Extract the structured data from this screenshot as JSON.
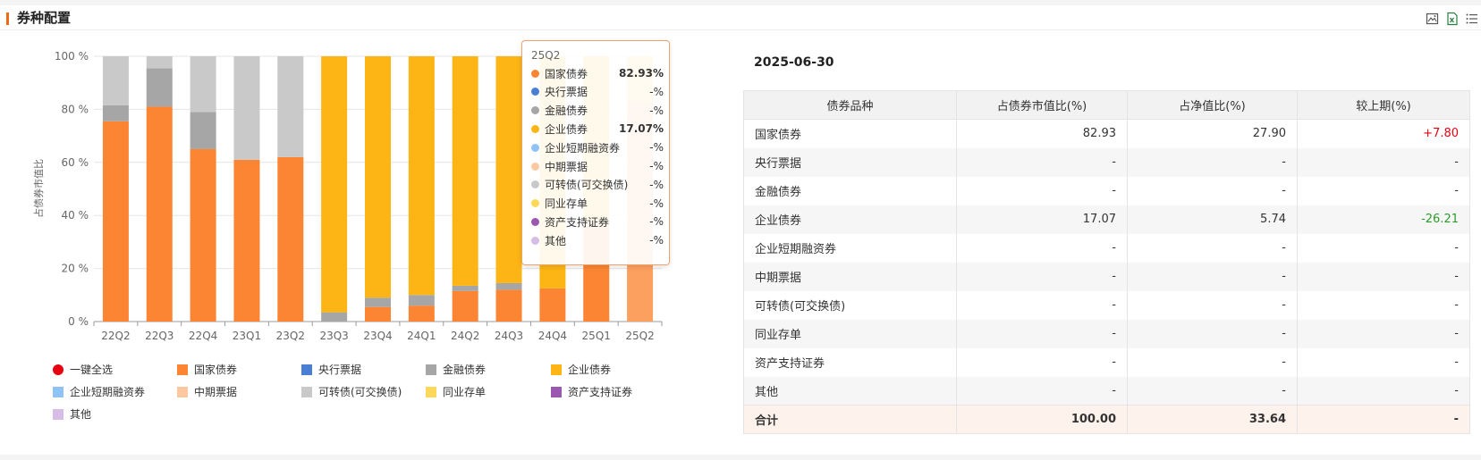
{
  "header": {
    "title": "券种配置",
    "tool_icons": [
      "image-export-icon",
      "excel-export-icon",
      "list-icon"
    ]
  },
  "chart_data": {
    "type": "bar",
    "stacked": true,
    "ylabel": "占债券市值比",
    "ylim": [
      0,
      100
    ],
    "yticks": [
      "0 %",
      "20 %",
      "40 %",
      "60 %",
      "80 %",
      "100 %"
    ],
    "categories": [
      "22Q2",
      "22Q3",
      "22Q4",
      "23Q1",
      "23Q2",
      "23Q3",
      "23Q4",
      "24Q1",
      "24Q2",
      "24Q3",
      "24Q4",
      "25Q1",
      "25Q2"
    ],
    "series": [
      {
        "name": "国家债券",
        "color": "#fb8533",
        "values": [
          75.5,
          81.0,
          65.0,
          61.0,
          62.0,
          0,
          5.5,
          6.0,
          11.5,
          12.0,
          12.5,
          37.0,
          82.93
        ]
      },
      {
        "name": "央行票据",
        "color": "#4a7fd3",
        "values": [
          0,
          0,
          0,
          0,
          0,
          0,
          0,
          0,
          0,
          0,
          0,
          0,
          0
        ]
      },
      {
        "name": "金融债券",
        "color": "#a6a6a6",
        "values": [
          6.0,
          14.5,
          14.0,
          0,
          0,
          3.5,
          3.5,
          4.0,
          2.0,
          2.5,
          0,
          0,
          0
        ]
      },
      {
        "name": "企业债券",
        "color": "#fcb514",
        "values": [
          0,
          0,
          0,
          0,
          0,
          96.5,
          91.0,
          90.0,
          86.5,
          85.5,
          87.5,
          63.0,
          17.07
        ]
      },
      {
        "name": "企业短期融资券",
        "color": "#8fc2f5",
        "values": [
          0,
          0,
          0,
          0,
          0,
          0,
          0,
          0,
          0,
          0,
          0,
          0,
          0
        ]
      },
      {
        "name": "中期票据",
        "color": "#fdc79f",
        "values": [
          0,
          0,
          0,
          0,
          0,
          0,
          0,
          0,
          0,
          0,
          0,
          0,
          0
        ]
      },
      {
        "name": "可转债(可交换债)",
        "color": "#c9c9c9",
        "values": [
          18.5,
          4.5,
          21.0,
          39.0,
          38.0,
          0,
          0,
          0,
          0,
          0,
          0,
          0,
          0
        ]
      },
      {
        "name": "同业存单",
        "color": "#fdd85a",
        "values": [
          0,
          0,
          0,
          0,
          0,
          0,
          0,
          0,
          0,
          0,
          0,
          0,
          0
        ]
      },
      {
        "name": "资产支持证券",
        "color": "#9a58b1",
        "values": [
          0,
          0,
          0,
          0,
          0,
          0,
          0,
          0,
          0,
          0,
          0,
          0,
          0
        ]
      },
      {
        "name": "其他",
        "color": "#d7bde6",
        "values": [
          0,
          0,
          0,
          0,
          0,
          0,
          0,
          0,
          0,
          0,
          0,
          0,
          0
        ]
      }
    ],
    "legend": {
      "select_all": "一键全选",
      "select_all_color": "#e60012",
      "placement": "bottom"
    },
    "tooltip": {
      "category": "25Q2",
      "rows": [
        {
          "name": "国家债券",
          "value": "82.93%",
          "bold": true
        },
        {
          "name": "央行票据",
          "value": "-%"
        },
        {
          "name": "金融债券",
          "value": "-%"
        },
        {
          "name": "企业债券",
          "value": "17.07%",
          "bold": true
        },
        {
          "name": "企业短期融资券",
          "value": "-%"
        },
        {
          "name": "中期票据",
          "value": "-%"
        },
        {
          "name": "可转债(可交换债)",
          "value": "-%"
        },
        {
          "name": "同业存单",
          "value": "-%"
        },
        {
          "name": "资产支持证券",
          "value": "-%"
        },
        {
          "name": "其他",
          "value": "-%"
        }
      ]
    }
  },
  "table": {
    "date": "2025-06-30",
    "headers": [
      "债券品种",
      "占债券市值比(%)",
      "占净值比(%)",
      "较上期(%)"
    ],
    "rows": [
      {
        "name": "国家债券",
        "mv": "82.93",
        "nav": "27.90",
        "chg": "+7.80",
        "dir": "up"
      },
      {
        "name": "央行票据",
        "mv": "-",
        "nav": "-",
        "chg": "-"
      },
      {
        "name": "金融债券",
        "mv": "-",
        "nav": "-",
        "chg": "-"
      },
      {
        "name": "企业债券",
        "mv": "17.07",
        "nav": "5.74",
        "chg": "-26.21",
        "dir": "down"
      },
      {
        "name": "企业短期融资券",
        "mv": "-",
        "nav": "-",
        "chg": "-"
      },
      {
        "name": "中期票据",
        "mv": "-",
        "nav": "-",
        "chg": "-"
      },
      {
        "name": "可转债(可交换债)",
        "mv": "-",
        "nav": "-",
        "chg": "-"
      },
      {
        "name": "同业存单",
        "mv": "-",
        "nav": "-",
        "chg": "-"
      },
      {
        "name": "资产支持证券",
        "mv": "-",
        "nav": "-",
        "chg": "-"
      },
      {
        "name": "其他",
        "mv": "-",
        "nav": "-",
        "chg": "-"
      }
    ],
    "total": {
      "name": "合计",
      "mv": "100.00",
      "nav": "33.64",
      "chg": "-"
    },
    "colors": {
      "up": "#e60012",
      "down": "#2a9d2a"
    }
  }
}
